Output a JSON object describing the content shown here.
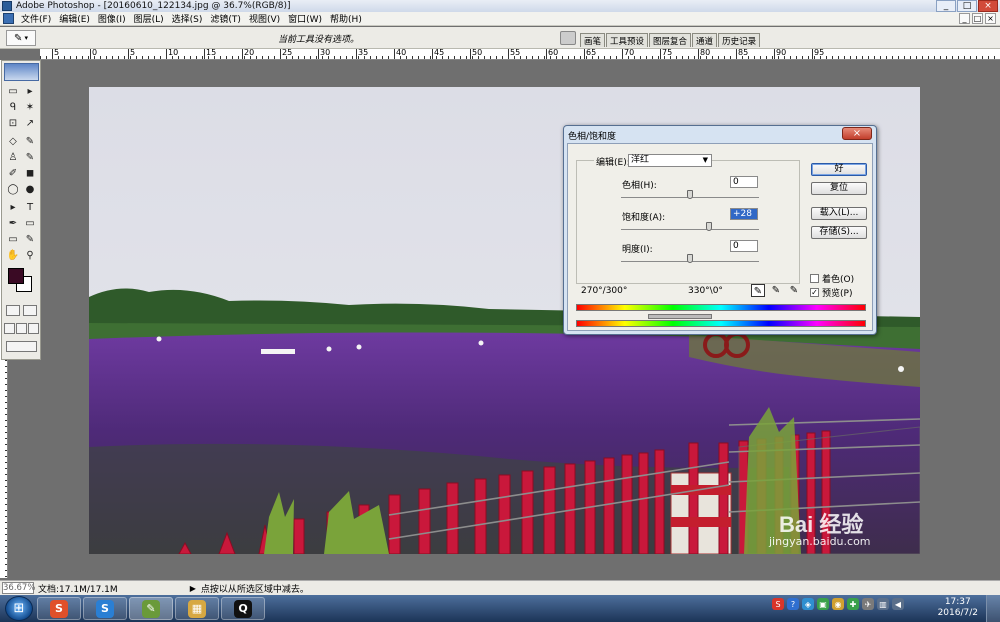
{
  "window": {
    "title": "Adobe Photoshop - [20160610_122134.jpg @ 36.7%(RGB/8)]",
    "controls": [
      "_",
      "□",
      "×"
    ]
  },
  "menubar": {
    "items": [
      {
        "label": "文件(F)"
      },
      {
        "label": "编辑(E)"
      },
      {
        "label": "图像(I)"
      },
      {
        "label": "图层(L)"
      },
      {
        "label": "选择(S)"
      },
      {
        "label": "滤镜(T)"
      },
      {
        "label": "视图(V)"
      },
      {
        "label": "窗口(W)"
      },
      {
        "label": "帮助(H)"
      }
    ],
    "doc_controls": [
      "_",
      "□",
      "×"
    ]
  },
  "optionsbar": {
    "hint": "当前工具没有选项。"
  },
  "palette_tabs": [
    "画笔",
    "工具预设",
    "图层复合",
    "通道",
    "历史记录"
  ],
  "rulers": {
    "horizontal_labels": [
      "5",
      "0",
      "5",
      "10",
      "15",
      "20",
      "25",
      "30",
      "35",
      "40",
      "45",
      "50",
      "55",
      "60",
      "65",
      "70",
      "75",
      "80",
      "85",
      "90",
      "95"
    ]
  },
  "toolbox": {
    "tools": [
      "▭",
      "▸",
      "ᑫ",
      "✶",
      "⊡",
      "↗",
      "◇",
      "✎",
      "♙",
      "✎",
      "✐",
      "◼",
      "◯",
      "●",
      "▸",
      "T",
      "✒",
      "▭",
      "▭",
      "✎",
      "✋",
      "⚲"
    ],
    "foreground_color": "#3a0a24",
    "background_color": "#ffffff"
  },
  "dialog": {
    "title": "色相/饱和度",
    "close": "×",
    "edit_label": "编辑(E):",
    "edit_value": "洋红",
    "params": [
      {
        "label": "色相(H):",
        "value": "0",
        "slider": 0.5
      },
      {
        "label": "饱和度(A):",
        "value": "+28",
        "slider": 0.64
      },
      {
        "label": "明度(I):",
        "value": "0",
        "slider": 0.5
      }
    ],
    "buttons": {
      "ok": "好",
      "reset": "复位",
      "load": "载入(L)...",
      "save": "存储(S)..."
    },
    "range_left": "270°/300°",
    "range_right": "330°\\0°",
    "colorize": {
      "label": "着色(O)",
      "checked": false
    },
    "preview": {
      "label": "预览(P)",
      "checked": true
    }
  },
  "statusbar": {
    "zoom": "36.67%",
    "docsize": "文档:17.1M/17.1M",
    "arrow": "▶",
    "message": "点按以从所选区域中减去。"
  },
  "taskbar": {
    "start": "⊞",
    "apps": [
      {
        "glyph": "S",
        "color": "#e0502a"
      },
      {
        "glyph": "S",
        "color": "#2a7fd4"
      },
      {
        "glyph": "✎",
        "color": "#6a9a3a"
      },
      {
        "glyph": "▦",
        "color": "#d7a842"
      },
      {
        "glyph": "Q",
        "color": "#111111"
      }
    ],
    "tray_icons": [
      {
        "glyph": "S",
        "color": "#d9352a"
      },
      {
        "glyph": "?",
        "color": "#2f6fd0"
      },
      {
        "glyph": "◈",
        "color": "#2f8fd0"
      },
      {
        "glyph": "▣",
        "color": "#3aa04a"
      },
      {
        "glyph": "◉",
        "color": "#d0a030"
      },
      {
        "glyph": "✚",
        "color": "#3aa04a"
      },
      {
        "glyph": "✈",
        "color": "#7a7a7a"
      },
      {
        "glyph": "▥",
        "color": "#5a6f8a"
      },
      {
        "glyph": "◀",
        "color": "#5a6f8a"
      }
    ],
    "time": "17:37",
    "date": "2016/7/2"
  },
  "watermark": {
    "logo_text": "Bai 经验",
    "url": "jingyan.baidu.com"
  }
}
